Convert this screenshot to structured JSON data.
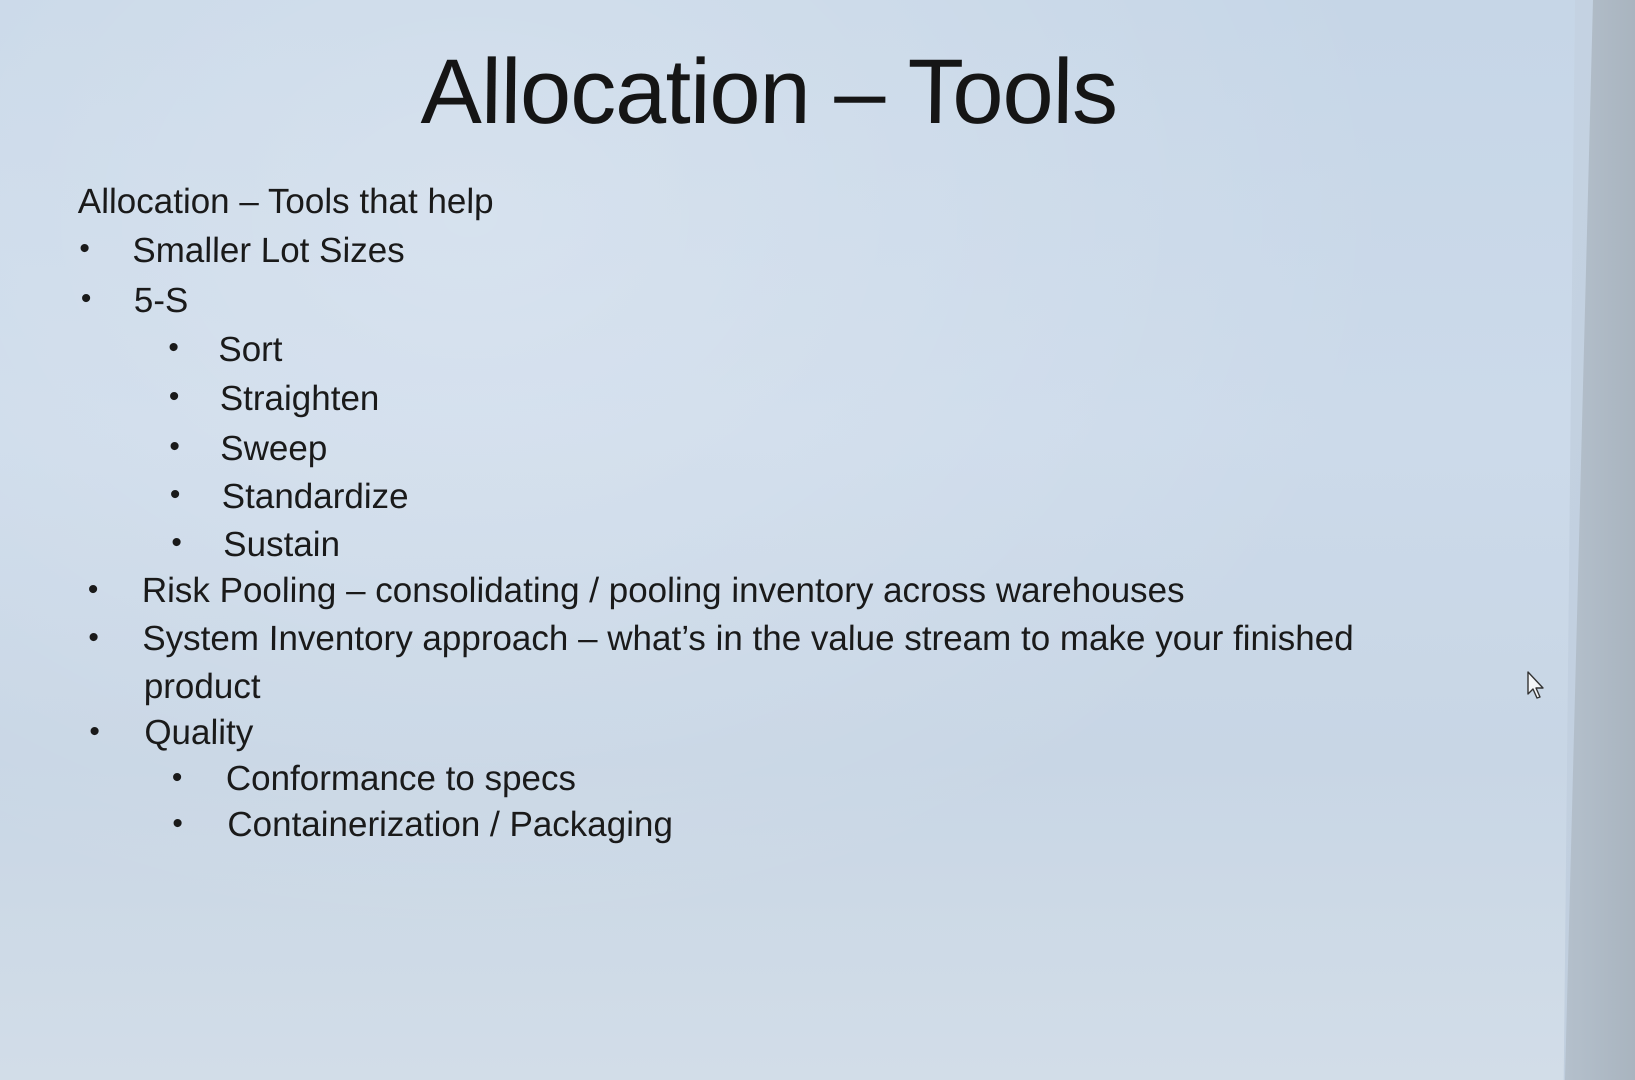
{
  "slide": {
    "title": "Allocation – Tools",
    "intro": "Allocation – Tools that help",
    "items": [
      {
        "text": "Smaller Lot Sizes",
        "level": 1
      },
      {
        "text": "5-S",
        "level": 1
      },
      {
        "text": "Sort",
        "level": 2
      },
      {
        "text": "Straighten",
        "level": 2
      },
      {
        "text": "Sweep",
        "level": 2
      },
      {
        "text": "Standardize",
        "level": 2
      },
      {
        "text": "Sustain",
        "level": 2
      },
      {
        "text": "Risk Pooling – consolidating / pooling inventory across warehouses",
        "level": 1
      },
      {
        "text": "System Inventory approach – what’s in the value stream to make your finished",
        "level": 1
      },
      {
        "text": "product",
        "level": 1,
        "continuation": true
      },
      {
        "text": "Quality",
        "level": 1
      },
      {
        "text": "Conformance to specs",
        "level": 2
      },
      {
        "text": "Containerization / Packaging",
        "level": 2
      }
    ],
    "bullet_glyph": "•",
    "icons": {
      "cursor": "mouse-pointer-icon"
    }
  }
}
